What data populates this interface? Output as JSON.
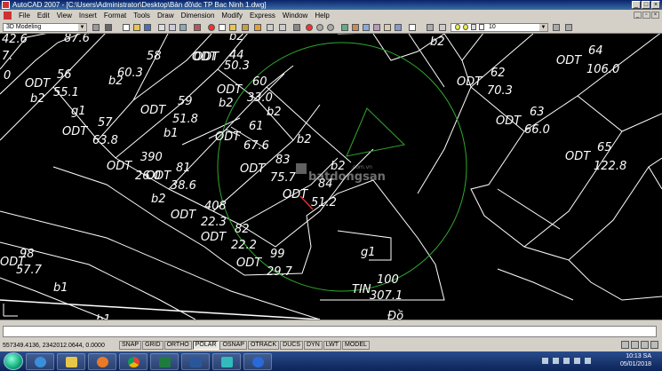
{
  "window": {
    "title": "AutoCAD 2007 - [C:\\Users\\Administrator\\Desktop\\Bản đồ\\dc TP Bac Ninh 1.dwg]"
  },
  "menu": [
    "File",
    "Edit",
    "View",
    "Insert",
    "Format",
    "Tools",
    "Draw",
    "Dimension",
    "Modify",
    "Express",
    "Window",
    "Help"
  ],
  "toolbar": {
    "workspace": "3D Modeling",
    "layer": "10"
  },
  "drawing": {
    "labels": [
      {
        "id": "l1",
        "t": "42.6"
      },
      {
        "id": "l2",
        "t": "87.6"
      },
      {
        "id": "l3",
        "t": "b2"
      },
      {
        "id": "l4",
        "t": "ODT"
      },
      {
        "id": "l5",
        "t": "58"
      },
      {
        "id": "l6",
        "t": "60.3"
      },
      {
        "id": "l7",
        "t": "ODT"
      },
      {
        "id": "l8",
        "t": "44"
      },
      {
        "id": "l9",
        "t": "50.3"
      },
      {
        "id": "l10",
        "t": "7."
      },
      {
        "id": "l11",
        "t": "0"
      },
      {
        "id": "l12",
        "t": "56"
      },
      {
        "id": "l13",
        "t": "ODT"
      },
      {
        "id": "l14",
        "t": "55.1"
      },
      {
        "id": "l15",
        "t": "b2"
      },
      {
        "id": "l16",
        "t": "b2"
      },
      {
        "id": "l17",
        "t": "g1"
      },
      {
        "id": "l18",
        "t": "ODT"
      },
      {
        "id": "l19",
        "t": "60"
      },
      {
        "id": "l20",
        "t": "33.0"
      },
      {
        "id": "l21",
        "t": "b2"
      },
      {
        "id": "l22",
        "t": "b2"
      },
      {
        "id": "l23",
        "t": "59"
      },
      {
        "id": "l24",
        "t": "ODT"
      },
      {
        "id": "l25",
        "t": "51.8"
      },
      {
        "id": "l26",
        "t": "57"
      },
      {
        "id": "l27",
        "t": "ODT"
      },
      {
        "id": "l28",
        "t": "63.8"
      },
      {
        "id": "l29",
        "t": "b1"
      },
      {
        "id": "l30",
        "t": "61"
      },
      {
        "id": "l31",
        "t": "ODT"
      },
      {
        "id": "l32",
        "t": "67.6"
      },
      {
        "id": "l33",
        "t": "b2"
      },
      {
        "id": "l34",
        "t": "390"
      },
      {
        "id": "l35",
        "t": "ODT"
      },
      {
        "id": "l36",
        "t": "26.0"
      },
      {
        "id": "l37",
        "t": "81"
      },
      {
        "id": "l38",
        "t": "ODT"
      },
      {
        "id": "l39",
        "t": "38.6"
      },
      {
        "id": "l40",
        "t": "ODT"
      },
      {
        "id": "l41",
        "t": "83"
      },
      {
        "id": "l42",
        "t": "75.7"
      },
      {
        "id": "l43",
        "t": "b2"
      },
      {
        "id": "l44",
        "t": "84"
      },
      {
        "id": "l45",
        "t": "ODT"
      },
      {
        "id": "l46",
        "t": "51.2"
      },
      {
        "id": "l47",
        "t": "b2"
      },
      {
        "id": "l48",
        "t": "408"
      },
      {
        "id": "l49",
        "t": "ODT"
      },
      {
        "id": "l50",
        "t": "22.3"
      },
      {
        "id": "l51",
        "t": "82"
      },
      {
        "id": "l52",
        "t": "ODT"
      },
      {
        "id": "l53",
        "t": "22.2"
      },
      {
        "id": "l54",
        "t": "99"
      },
      {
        "id": "l55",
        "t": "ODT"
      },
      {
        "id": "l56",
        "t": "29.7"
      },
      {
        "id": "l57",
        "t": "g1"
      },
      {
        "id": "l58",
        "t": "98"
      },
      {
        "id": "l59",
        "t": "ODT"
      },
      {
        "id": "l60",
        "t": "57.7"
      },
      {
        "id": "l61",
        "t": "b1"
      },
      {
        "id": "l62",
        "t": "b1"
      },
      {
        "id": "l63",
        "t": "TIN"
      },
      {
        "id": "l64",
        "t": "100"
      },
      {
        "id": "l65",
        "t": "307.1"
      },
      {
        "id": "l66",
        "t": "Đồ"
      },
      {
        "id": "l67",
        "t": "b2"
      },
      {
        "id": "l68",
        "t": "64"
      },
      {
        "id": "l69",
        "t": "ODT"
      },
      {
        "id": "l70",
        "t": "106.0"
      },
      {
        "id": "l71",
        "t": "62"
      },
      {
        "id": "l72",
        "t": "ODT"
      },
      {
        "id": "l73",
        "t": "70.3"
      },
      {
        "id": "l74",
        "t": "63"
      },
      {
        "id": "l75",
        "t": "ODT"
      },
      {
        "id": "l76",
        "t": "66.0"
      },
      {
        "id": "l77",
        "t": "65"
      },
      {
        "id": "l78",
        "t": "ODT"
      },
      {
        "id": "l79",
        "t": "122.8"
      }
    ],
    "watermark": "batdongsan",
    "watermark_sub": ".com.vn"
  },
  "status": {
    "coordinates": "557349.4136, 2342012.0644, 0.0000",
    "buttons": [
      {
        "label": "SNAP",
        "on": false
      },
      {
        "label": "GRID",
        "on": false
      },
      {
        "label": "ORTHO",
        "on": false
      },
      {
        "label": "POLAR",
        "on": true
      },
      {
        "label": "OSNAP",
        "on": false
      },
      {
        "label": "OTRACK",
        "on": false
      },
      {
        "label": "DUCS",
        "on": false
      },
      {
        "label": "DYN",
        "on": false
      },
      {
        "label": "LWT",
        "on": false
      },
      {
        "label": "MODEL",
        "on": false
      }
    ]
  },
  "taskbar": {
    "time": "10:13 SA",
    "date": "05/01/2018"
  },
  "colors": {
    "drawing_bg": "#000000",
    "lines": "#ffffff",
    "circle": "#2fa82f",
    "taskbar": "#1c3a78"
  }
}
